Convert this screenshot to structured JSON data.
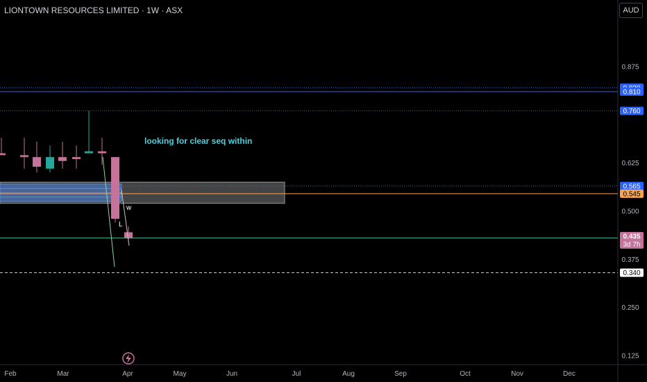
{
  "header": {
    "title": "LIONTOWN RESOURCES LIMITED · 1W · ASX",
    "currency": "AUD"
  },
  "colors": {
    "up": "#26a69a",
    "down": "#c5739a",
    "bg": "#000000",
    "blue_level": "#2962ff",
    "orange_level": "#f7a350",
    "green_level": "#4fc3a1",
    "annotation": "#4dd0e1"
  },
  "chart_data": {
    "type": "candlestick",
    "ylim": [
      0.1,
      1.0
    ],
    "x_tick_labels": [
      "Feb",
      "Mar",
      "Apr",
      "May",
      "Jun",
      "Jul",
      "Aug",
      "Sep",
      "Oct",
      "Nov",
      "Dec"
    ],
    "y_tick_labels": [
      "0.875",
      "0.625",
      "0.500",
      "0.375",
      "0.250",
      "0.125"
    ],
    "y_ticks": [
      0.875,
      0.625,
      0.5,
      0.375,
      0.25,
      0.125
    ],
    "candles": [
      {
        "o": 0.66,
        "h": 0.67,
        "l": 0.645,
        "c": 0.65
      },
      {
        "o": 0.65,
        "h": 0.69,
        "l": 0.645,
        "c": 0.645
      },
      {
        "o": 0.645,
        "h": 0.69,
        "l": 0.61,
        "c": 0.64
      },
      {
        "o": 0.64,
        "h": 0.68,
        "l": 0.6,
        "c": 0.615
      },
      {
        "o": 0.61,
        "h": 0.67,
        "l": 0.6,
        "c": 0.64
      },
      {
        "o": 0.64,
        "h": 0.68,
        "l": 0.61,
        "c": 0.63
      },
      {
        "o": 0.64,
        "h": 0.67,
        "l": 0.61,
        "c": 0.635
      },
      {
        "o": 0.65,
        "h": 0.76,
        "l": 0.65,
        "c": 0.655
      },
      {
        "o": 0.655,
        "h": 0.69,
        "l": 0.62,
        "c": 0.65
      },
      {
        "o": 0.64,
        "h": 0.64,
        "l": 0.47,
        "c": 0.48
      },
      {
        "o": 0.445,
        "h": 0.46,
        "l": 0.42,
        "c": 0.43
      }
    ],
    "levels": [
      {
        "value": 0.82,
        "label": "0.820",
        "color": "#2962ff",
        "style": "dotted",
        "tag_bg": "#2962ff",
        "tag_fg": "#ffffff"
      },
      {
        "value": 0.81,
        "label": "0.810",
        "color": "#2962ff",
        "style": "solid",
        "tag_bg": "#2962ff",
        "tag_fg": "#ffffff"
      },
      {
        "value": 0.76,
        "label": "0.760",
        "color": "#2962ff",
        "style": "dotted",
        "tag_bg": "#2962ff",
        "tag_fg": "#ffffff"
      },
      {
        "value": 0.565,
        "label": "0.565",
        "color": "#2962ff",
        "style": "dotted",
        "tag_bg": "#2962ff",
        "tag_fg": "#ffffff"
      },
      {
        "value": 0.545,
        "label": "0.545",
        "color": "#f7a350",
        "style": "solid",
        "tag_bg": "#f7a350",
        "tag_fg": "#000000"
      },
      {
        "value": 0.43,
        "label": "0.430",
        "color": "#4fc3a1",
        "style": "solid",
        "tag_bg": "#4fc3a1",
        "tag_fg": "#000000"
      },
      {
        "value": 0.34,
        "label": "0.340",
        "color": "#d1d4dc",
        "style": "dashed",
        "tag_bg": "#ffffff",
        "tag_fg": "#000000"
      }
    ],
    "last_price": {
      "value": 0.435,
      "label": "0.435",
      "countdown": "3d 7h",
      "color": "#c5739a"
    },
    "zones": [
      {
        "top": 0.575,
        "bottom": 0.52,
        "color": "#7c7c7c"
      },
      {
        "top": 0.57,
        "bottom": 0.525,
        "color": "#4a78c8"
      }
    ],
    "annotation": {
      "text": "looking for clear seq within"
    },
    "wave_labels": [
      "w",
      "L"
    ]
  }
}
